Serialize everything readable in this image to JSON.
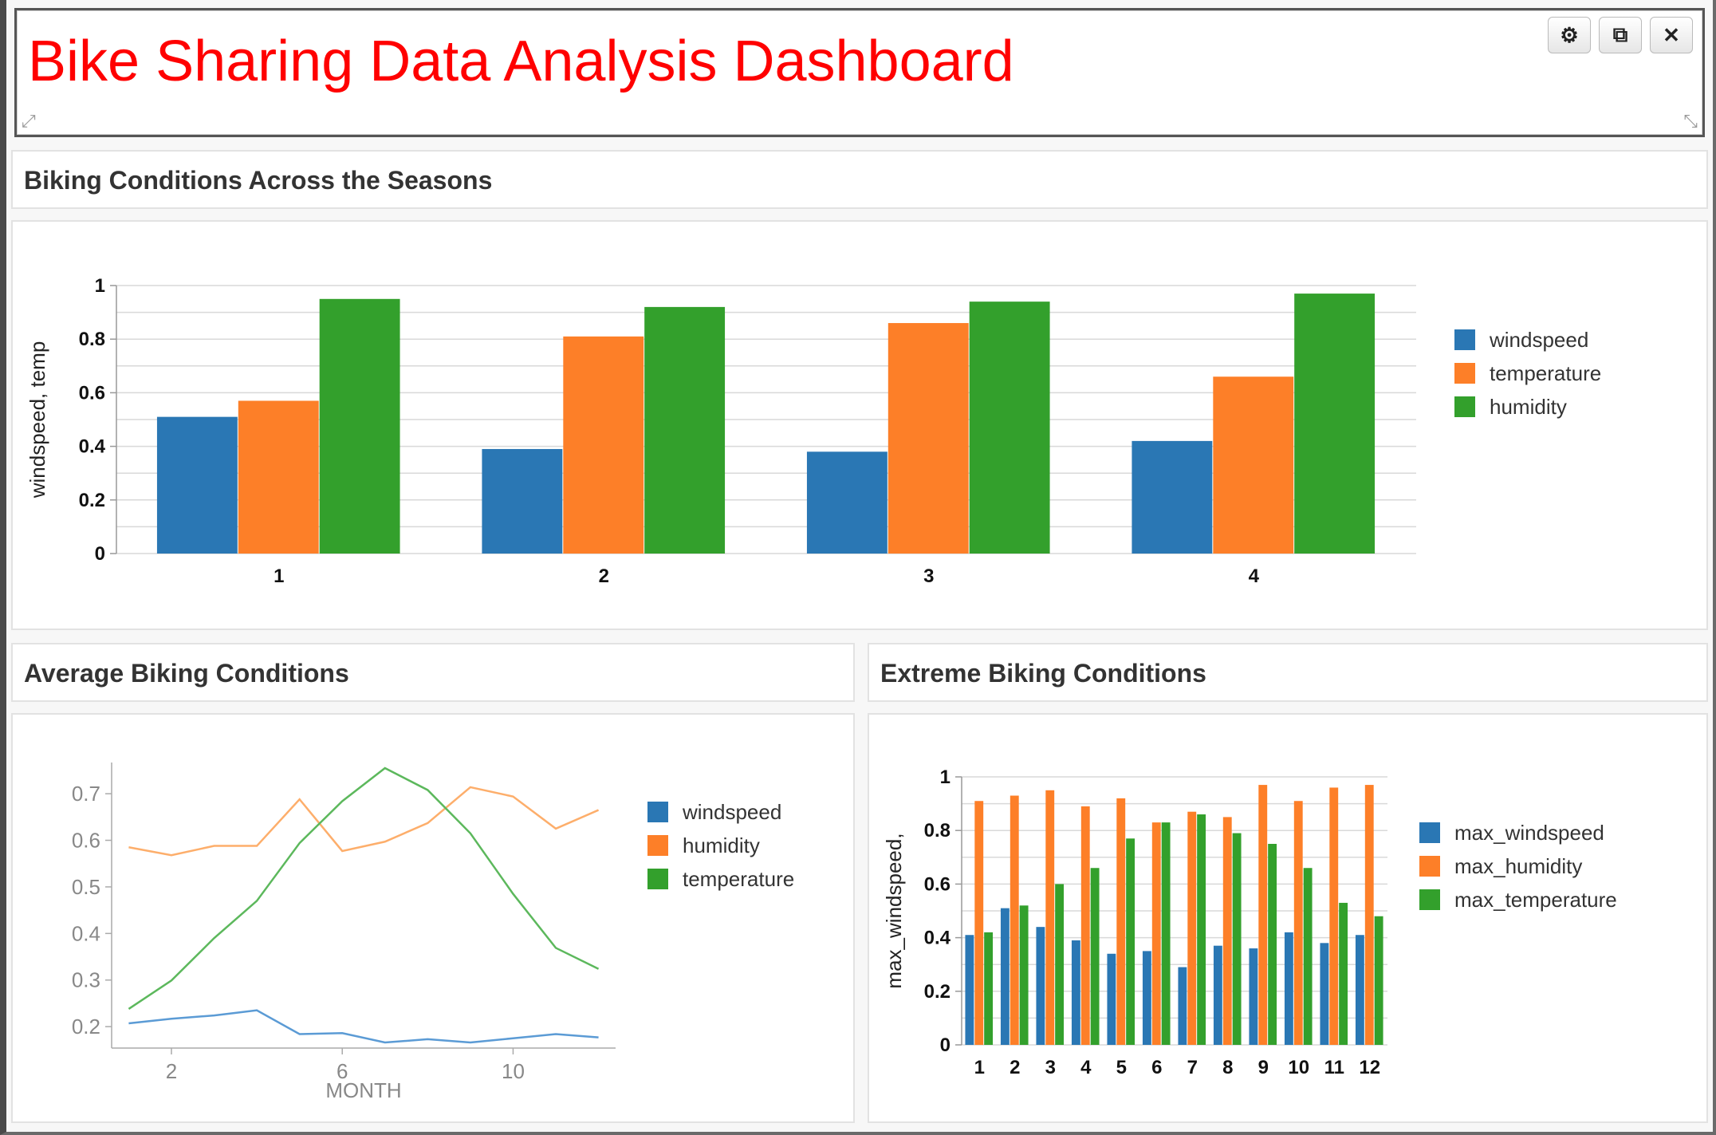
{
  "page_title": "Bike Sharing Data Analysis Dashboard",
  "window_controls": [
    {
      "name": "gear-icon",
      "glyph": "⚙"
    },
    {
      "name": "external-link-icon",
      "glyph": "⧉"
    },
    {
      "name": "close-icon",
      "glyph": "✕"
    }
  ],
  "colors": {
    "blue": "#2a77b4",
    "orange": "#fd7f28",
    "green": "#33a02c",
    "title_red": "#ff0000"
  },
  "panels": {
    "seasons": {
      "title": "Biking Conditions Across the Seasons"
    },
    "average": {
      "title": "Average Biking Conditions"
    },
    "extreme": {
      "title": "Extreme Biking Conditions"
    }
  },
  "chart_data": [
    {
      "type": "bar",
      "title": "Biking Conditions Across the Seasons",
      "categories": [
        "1",
        "2",
        "3",
        "4"
      ],
      "series": [
        {
          "name": "windspeed",
          "color": "#2a77b4",
          "values": [
            0.51,
            0.39,
            0.38,
            0.42
          ]
        },
        {
          "name": "temperature",
          "color": "#fd7f28",
          "values": [
            0.57,
            0.81,
            0.86,
            0.66
          ]
        },
        {
          "name": "humidity",
          "color": "#33a02c",
          "values": [
            0.95,
            0.92,
            0.94,
            0.97
          ]
        }
      ],
      "ylabel": "windspeed, temp",
      "ylim": [
        0,
        1
      ],
      "yticks": [
        "0",
        "0.2",
        "0.4",
        "0.6",
        "0.8",
        "1"
      ],
      "legend": "right",
      "grid": true
    },
    {
      "type": "line",
      "title": "Average Biking Conditions",
      "x": [
        1,
        2,
        3,
        4,
        5,
        6,
        7,
        8,
        9,
        10,
        11,
        12
      ],
      "series": [
        {
          "name": "windspeed",
          "color": "#5b9bd5",
          "values": [
            0.207,
            0.217,
            0.224,
            0.235,
            0.184,
            0.186,
            0.166,
            0.173,
            0.166,
            0.175,
            0.184,
            0.177
          ]
        },
        {
          "name": "humidity",
          "color": "#fdae6b",
          "values": [
            0.585,
            0.568,
            0.588,
            0.588,
            0.688,
            0.577,
            0.597,
            0.637,
            0.714,
            0.694,
            0.625,
            0.665
          ]
        },
        {
          "name": "temperature",
          "color": "#5cb85c",
          "values": [
            0.238,
            0.299,
            0.39,
            0.47,
            0.594,
            0.684,
            0.755,
            0.708,
            0.615,
            0.485,
            0.369,
            0.324
          ]
        }
      ],
      "xlabel": "MONTH",
      "xticks": [
        "2",
        "6",
        "10"
      ],
      "yticks": [
        "0.2",
        "0.3",
        "0.4",
        "0.5",
        "0.6",
        "0.7"
      ],
      "legend": "right",
      "grid": false
    },
    {
      "type": "bar",
      "title": "Extreme Biking Conditions",
      "categories": [
        "1",
        "2",
        "3",
        "4",
        "5",
        "6",
        "7",
        "8",
        "9",
        "10",
        "11",
        "12"
      ],
      "series": [
        {
          "name": "max_windspeed",
          "color": "#2a77b4",
          "values": [
            0.41,
            0.51,
            0.44,
            0.39,
            0.34,
            0.35,
            0.29,
            0.37,
            0.36,
            0.42,
            0.38,
            0.41
          ]
        },
        {
          "name": "max_humidity",
          "color": "#fd7f28",
          "values": [
            0.91,
            0.93,
            0.95,
            0.89,
            0.92,
            0.83,
            0.87,
            0.85,
            0.97,
            0.91,
            0.96,
            0.97
          ]
        },
        {
          "name": "max_temperature",
          "color": "#33a02c",
          "values": [
            0.42,
            0.52,
            0.6,
            0.66,
            0.77,
            0.83,
            0.86,
            0.79,
            0.75,
            0.66,
            0.53,
            0.48
          ]
        }
      ],
      "ylabel": "max_windspeed,",
      "ylim": [
        0,
        1
      ],
      "yticks": [
        "0",
        "0.2",
        "0.4",
        "0.6",
        "0.8",
        "1"
      ],
      "legend": "right",
      "grid": true
    }
  ]
}
